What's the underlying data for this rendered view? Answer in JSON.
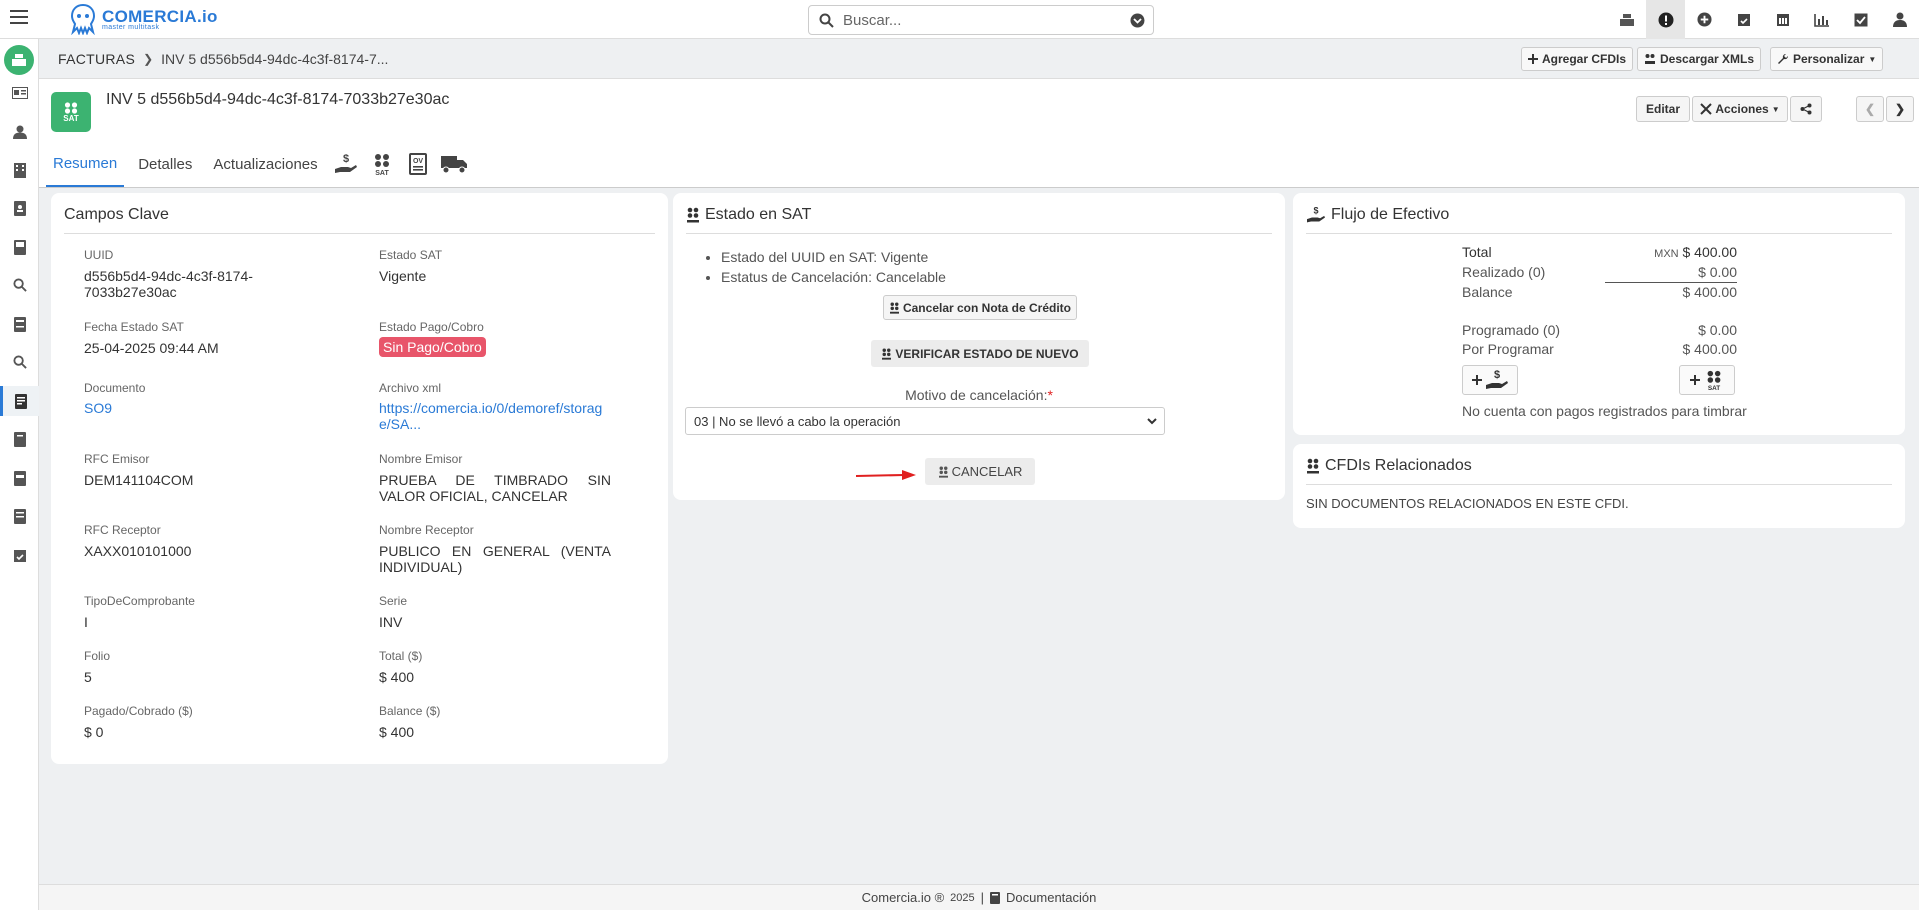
{
  "app": {
    "logo_text": "COMERCIA.io",
    "logo_tagline": "master multitask"
  },
  "search": {
    "placeholder": "Buscar..."
  },
  "topbar_icons": [
    "cash-register-icon",
    "alert-icon",
    "plus-circle-icon",
    "calendar-check-icon",
    "calendar-icon",
    "chart-icon",
    "checkbox-icon",
    "user-icon"
  ],
  "breadcrumb": {
    "root": "FACTURAS",
    "current": "INV 5 d556b5d4-94dc-4c3f-8174-7..."
  },
  "crumb_buttons": {
    "add_cfdis": "Agregar CFDIs",
    "download_xmls": "Descargar XMLs",
    "customize": "Personalizar"
  },
  "header": {
    "badge": "SAT",
    "title": "INV 5 d556b5d4-94dc-4c3f-8174-7033b27e30ac",
    "edit": "Editar",
    "actions": "Acciones"
  },
  "tabs": [
    "Resumen",
    "Detalles",
    "Actualizaciones"
  ],
  "campos": {
    "title": "Campos Clave",
    "uuid_label": "UUID",
    "uuid_value": "d556b5d4-94dc-4c3f-8174-7033b27e30ac",
    "estado_sat_label": "Estado SAT",
    "estado_sat_value": "Vigente",
    "fecha_label": "Fecha Estado SAT",
    "fecha_value": "25-04-2025 09:44 AM",
    "pago_label": "Estado Pago/Cobro",
    "pago_value": "Sin Pago/Cobro",
    "doc_label": "Documento",
    "doc_value": "SO9",
    "xml_label": "Archivo xml",
    "xml_value": "https://comercia.io/0/demoref/storage/SA...",
    "rfc_emisor_label": "RFC Emisor",
    "rfc_emisor_value": "DEM141104COM",
    "nombre_emisor_label": "Nombre Emisor",
    "nombre_emisor_value": "PRUEBA DE TIMBRADO SIN VALOR OFICIAL, CANCELAR",
    "rfc_receptor_label": "RFC Receptor",
    "rfc_receptor_value": "XAXX010101000",
    "nombre_receptor_label": "Nombre Receptor",
    "nombre_receptor_value": "PUBLICO EN GENERAL (VENTA INDIVIDUAL)",
    "tipo_label": "TipoDeComprobante",
    "tipo_value": "I",
    "serie_label": "Serie",
    "serie_value": "INV",
    "folio_label": "Folio",
    "folio_value": "5",
    "total_label": "Total ($)",
    "total_value": "$ 400",
    "pagado_label": "Pagado/Cobrado ($)",
    "pagado_value": "$ 0",
    "balance_label": "Balance ($)",
    "balance_value": "$ 400"
  },
  "sat": {
    "title": "Estado en SAT",
    "bullet1": "Estado del UUID en SAT: Vigente",
    "bullet2": "Estatus de Cancelación: Cancelable",
    "nota_button": "Cancelar con Nota de Crédito",
    "verify_button": "VERIFICAR ESTADO DE NUEVO",
    "motivo_label": "Motivo de cancelación:",
    "required_mark": "*",
    "motivo_value": "03 | No se llevó a cabo la operación",
    "cancel_button": "CANCELAR"
  },
  "flujo": {
    "title": "Flujo de Efectivo",
    "total_label": "Total",
    "currency": "MXN",
    "total_value": "$ 400.00",
    "realizado_label": "Realizado (0)",
    "realizado_value": "$ 0.00",
    "balance_label": "Balance",
    "balance_value": "$ 400.00",
    "programado_label": "Programado (0)",
    "programado_value": "$ 0.00",
    "por_programar_label": "Por Programar",
    "por_programar_value": "$ 400.00",
    "empty_text": "No cuenta con pagos registrados para timbrar"
  },
  "relacionados": {
    "title": "CFDIs Relacionados",
    "empty_text": "SIN DOCUMENTOS RELACIONADOS EN ESTE CFDI."
  },
  "footer": {
    "brand": "Comercia.io ®",
    "year": "2025",
    "sep": "|",
    "docs": "Documentación"
  },
  "colors": {
    "accent": "#2a7ad6",
    "sat_green": "#3cb371",
    "danger": "#e8556a",
    "arrow": "#e02020"
  }
}
